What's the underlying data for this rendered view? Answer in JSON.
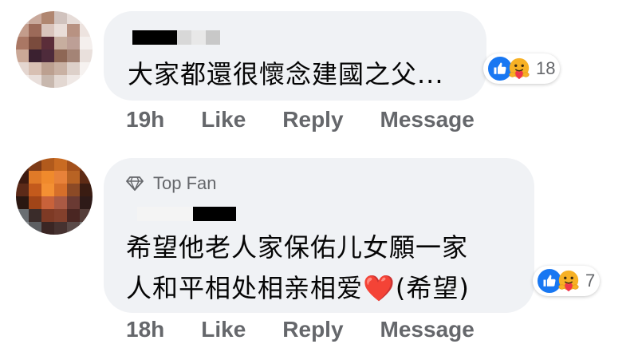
{
  "comments": [
    {
      "text": "大家都還很懷念建國之父...",
      "reaction_count": "18",
      "time": "19h",
      "like_label": "Like",
      "reply_label": "Reply",
      "message_label": "Message"
    },
    {
      "badge": "Top Fan",
      "text_line1": "希望他老人家保佑儿女願一家",
      "text_line2": "人和平相处相亲相爱❤️(希望)",
      "reaction_count": "7",
      "time": "18h",
      "like_label": "Like",
      "reply_label": "Reply",
      "message_label": "Message"
    }
  ],
  "colors": {
    "bubble": "#f0f2f5",
    "like_blue": "#1877f2",
    "muted_text": "#65676b"
  }
}
